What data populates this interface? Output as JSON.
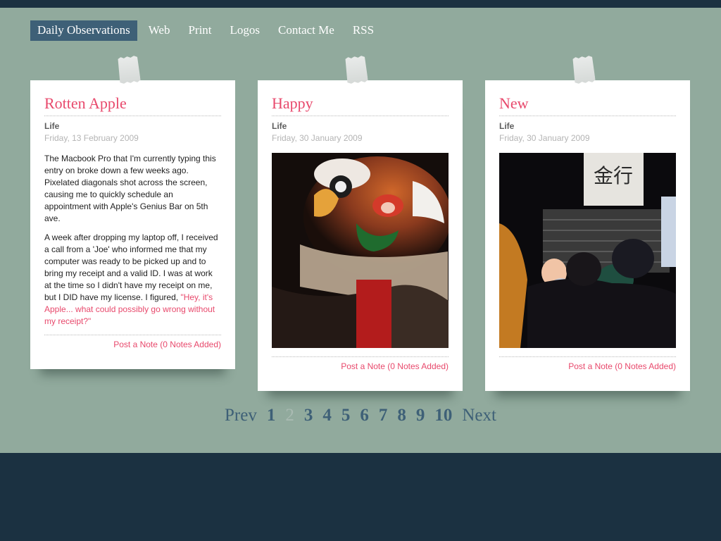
{
  "nav": {
    "items": [
      "Daily Observations",
      "Web",
      "Print",
      "Logos",
      "Contact Me",
      "RSS"
    ],
    "active": "Daily Observations"
  },
  "cards": [
    {
      "title": "Rotten Apple",
      "category": "Life",
      "date": "Friday, 13 February 2009",
      "paragraph1": "The Macbook Pro that I'm currently typing this entry on broke down a few weeks ago. Pixelated diagonals shot across the screen, causing me to quickly schedule an appointment with Apple's Genius Bar on 5th ave.",
      "paragraph2": "A week after dropping my laptop off, I received a call from a 'Joe' who informed me that my computer was ready to be picked up and to bring my receipt and a valid ID. I was at work at the time so I didn't have my receipt on me, but I DID have my license. I figured,",
      "quote": "\"Hey, it's Apple... what could possibly go wrong without my receipt?\"",
      "note_link": "Post a Note (0 Notes Added)"
    },
    {
      "title": "Happy",
      "category": "Life",
      "date": "Friday, 30 January 2009",
      "photo_icon": "lion-dance-photo",
      "note_link": "Post a Note (0 Notes Added)"
    },
    {
      "title": "New",
      "category": "Life",
      "date": "Friday, 30 January 2009",
      "photo_icon": "street-crowd-photo",
      "sign_text": "金行",
      "note_link": "Post a Note (0 Notes Added)"
    }
  ],
  "pagination": {
    "prev": "Prev",
    "next": "Next",
    "pages": [
      "1",
      "2",
      "3",
      "4",
      "5",
      "6",
      "7",
      "8",
      "9",
      "10"
    ],
    "current": "2"
  },
  "colors": {
    "background": "#91aa9d",
    "dark": "#1b3141",
    "accent": "#e8496c",
    "nav_active": "#3e6077"
  }
}
